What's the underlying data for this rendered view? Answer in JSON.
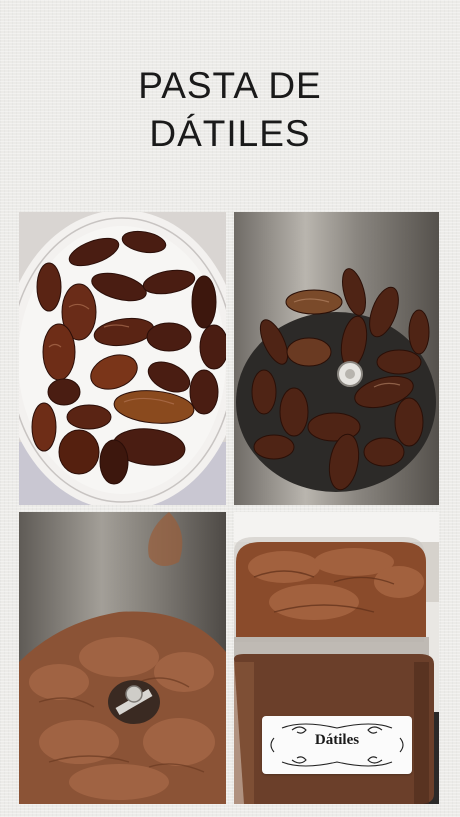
{
  "title": {
    "line1": "PASTA DE",
    "line2": "DÁTILES"
  },
  "jar_label": {
    "text": "Dátiles"
  },
  "colors": {
    "background": "#ecebe8",
    "title_text": "#1a1a1a",
    "date_brown": "#5a2a1a",
    "paste_brown": "#8a5033",
    "steel": "#7b7772"
  }
}
